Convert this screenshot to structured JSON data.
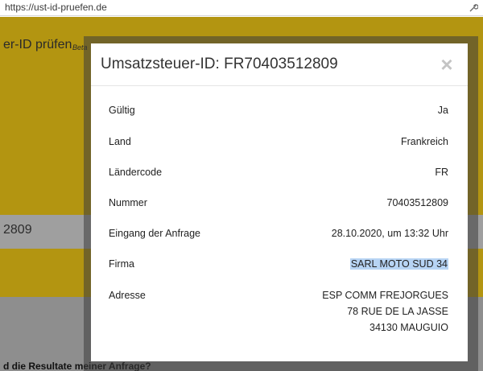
{
  "browser": {
    "url": "https://ust-id-pruefen.de"
  },
  "background": {
    "title": "er-ID prüfen",
    "beta": "Beta",
    "input_value": "2809",
    "question": "d die Resultate meiner Anfrage?"
  },
  "modal": {
    "title": "Umsatzsteuer-ID: FR70403512809",
    "close_label": "×",
    "rows": [
      {
        "label": "Gültig",
        "value": "Ja"
      },
      {
        "label": "Land",
        "value": "Frankreich"
      },
      {
        "label": "Ländercode",
        "value": "FR"
      },
      {
        "label": "Nummer",
        "value": "70403512809"
      },
      {
        "label": "Eingang der Anfrage",
        "value": "28.10.2020, um 13:32 Uhr"
      },
      {
        "label": "Firma",
        "value": "SARL MOTO SUD 34"
      },
      {
        "label": "Adresse",
        "value_lines": [
          "ESP COMM FREJORGUES",
          "78 RUE DE LA JASSE",
          "34130 MAUGUIO"
        ]
      }
    ]
  },
  "colors": {
    "page_band": "#b39511",
    "selection_highlight": "#b7d4f4"
  }
}
